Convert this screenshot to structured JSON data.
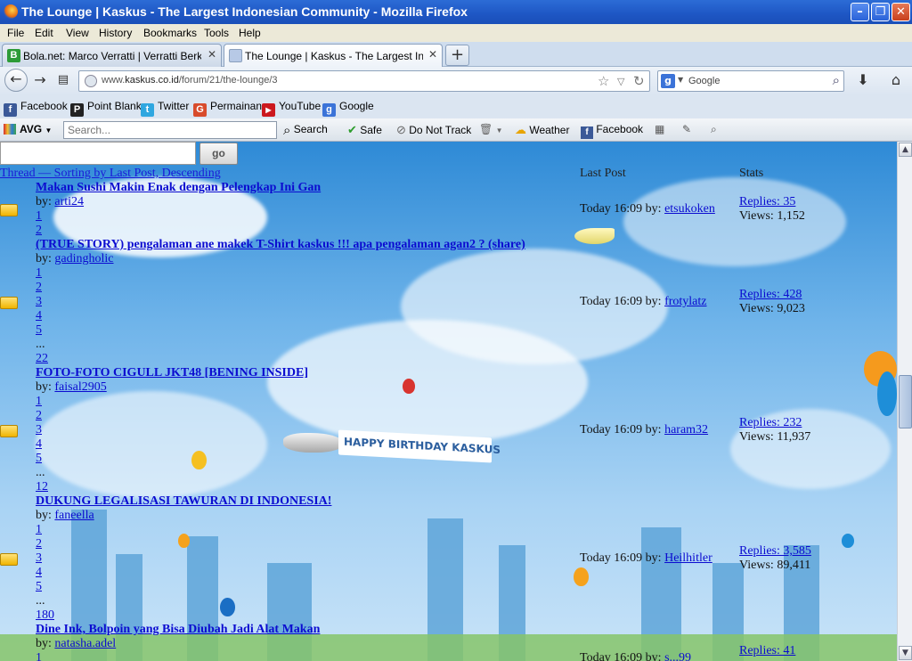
{
  "window": {
    "title": "The Lounge | Kaskus - The Largest Indonesian Community - Mozilla Firefox"
  },
  "menu": [
    "File",
    "Edit",
    "View",
    "History",
    "Bookmarks",
    "Tools",
    "Help"
  ],
  "tabs": [
    {
      "label": "Bola.net: Marco Verratti | Verratti Berkisa...",
      "active": false,
      "favicon_color": "#2d9b38"
    },
    {
      "label": "The Lounge | Kaskus - The Largest Indon...",
      "active": true,
      "favicon_color": "#b7c9e6"
    }
  ],
  "nav": {
    "url_prefix": "www.",
    "url_domain": "kaskus.co.id",
    "url_path": "/forum/21/the-lounge/3",
    "search_placeholder": "Google"
  },
  "bookmarks": [
    {
      "label": "Facebook",
      "icon": "facebook-icon",
      "color": "#3b5998",
      "glyph": "f"
    },
    {
      "label": "Point Blank",
      "icon": "point-blank-icon",
      "color": "#222222",
      "glyph": "P"
    },
    {
      "label": "Twitter",
      "icon": "twitter-icon",
      "color": "#2fa7e0",
      "glyph": "t"
    },
    {
      "label": "Permainan",
      "icon": "permainan-icon",
      "color": "#d84b2b",
      "glyph": "G"
    },
    {
      "label": "YouTube",
      "icon": "youtube-icon",
      "color": "#cc181e",
      "glyph": "▶"
    },
    {
      "label": "Google",
      "icon": "google-icon",
      "color": "#3b73d8",
      "glyph": "g"
    }
  ],
  "avg": {
    "brand": "AVG",
    "search_placeholder": "Search...",
    "search_label": "Search",
    "safe_label": "Safe",
    "dnt_label": "Do Not Track",
    "weather_label": "Weather",
    "facebook_label": "Facebook"
  },
  "forum": {
    "go_label": "go",
    "header_thread": "Thread",
    "header_sort": " — Sorting by Last Post, Descending",
    "header_last_post": "Last Post",
    "header_stats": "Stats",
    "banner_text": "HAPPY BIRTHDAY KASKUS",
    "threads": [
      {
        "title": "Makan Sushi Makin Enak dengan Pelengkap Ini Gan",
        "by_label": "by: ",
        "author": "arti24",
        "pages": [
          "1",
          "2"
        ],
        "last_post_time": "Today 16:09 by: ",
        "last_post_user": "etsukoken",
        "replies": "Replies: 35",
        "views": "Views: 1,152"
      },
      {
        "title": "(TRUE STORY) pengalaman ane makek T-Shirt kaskus !!! apa pengalaman agan2 ? (share)",
        "by_label": "by: ",
        "author": "gadingholic",
        "pages": [
          "1",
          "2",
          "3",
          "4",
          "5",
          "...",
          "22"
        ],
        "last_post_time": "Today 16:09 by: ",
        "last_post_user": "frotylatz",
        "replies": "Replies: 428",
        "views": "Views: 9,023"
      },
      {
        "title": "FOTO-FOTO CIGULL JKT48 [BENING INSIDE]",
        "by_label": "by: ",
        "author": "faisal2905",
        "pages": [
          "1",
          "2",
          "3",
          "4",
          "5",
          "...",
          "12"
        ],
        "last_post_time": "Today 16:09 by: ",
        "last_post_user": "haram32",
        "replies": "Replies: 232",
        "views": "Views: 11,937"
      },
      {
        "title": "DUKUNG LEGALISASI TAWURAN DI INDONESIA!",
        "by_label": "by: ",
        "author": "faneella",
        "pages": [
          "1",
          "2",
          "3",
          "4",
          "5",
          "...",
          "180"
        ],
        "last_post_time": "Today 16:09 by: ",
        "last_post_user": "Heilhitler",
        "replies": "Replies: 3,585",
        "views": "Views: 89,411"
      },
      {
        "title": "Dine Ink, Bolpoin yang Bisa Diubah Jadi Alat Makan",
        "by_label": "by: ",
        "author": "natasha.adel",
        "pages": [
          "1"
        ],
        "last_post_time": "Today 16:09 by: ",
        "last_post_user": "s...99",
        "replies": "Replies: 41",
        "views": ""
      }
    ]
  }
}
